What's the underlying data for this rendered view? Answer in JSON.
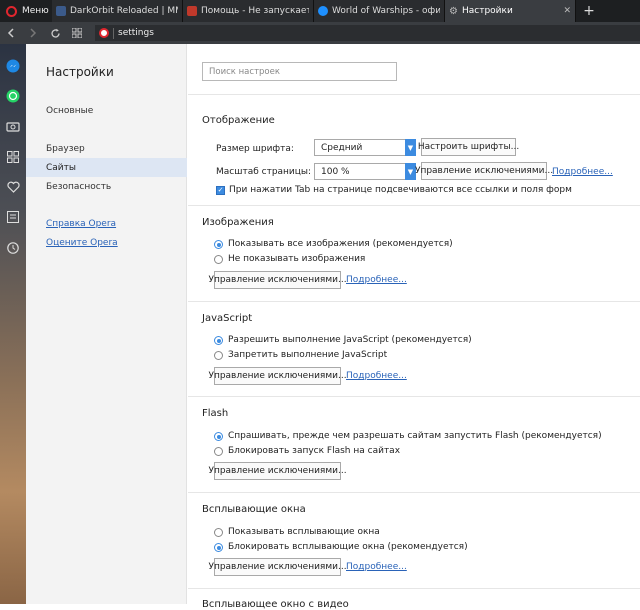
{
  "browser": {
    "menu_label": "Меню",
    "tabs": [
      {
        "title": "DarkOrbit Reloaded | MMO",
        "favicon_color": "#3b5a8a"
      },
      {
        "title": "Помощь - Не запускается",
        "favicon_color": "#c0392b"
      },
      {
        "title": "World of Warships - офиц",
        "favicon_color": "#1e90ff"
      },
      {
        "title": "Настройки",
        "favicon_color": "#9aa0a6"
      }
    ],
    "new_tab_symbol": "+",
    "address": "settings"
  },
  "settings_nav": {
    "title": "Настройки",
    "items": [
      "Основные",
      "Браузер",
      "Сайты",
      "Безопасность"
    ],
    "selected_index": 2,
    "links": [
      "Справка Opera",
      "Оцените Opera"
    ]
  },
  "search": {
    "placeholder": "Поиск настроек"
  },
  "display": {
    "title": "Отображение",
    "font_size_label": "Размер шрифта:",
    "font_size_value": "Средний",
    "configure_fonts_button": "Настроить шрифты...",
    "zoom_label": "Масштаб страницы:",
    "zoom_value": "100 %",
    "manage_exceptions_button": "Управление исключениями...",
    "more_link": "Подробнее...",
    "tab_highlight_label": "При нажатии Tab на странице подсвечиваются все ссылки и поля форм",
    "tab_highlight_checked": true
  },
  "images": {
    "title": "Изображения",
    "options": [
      "Показывать все изображения (рекомендуется)",
      "Не показывать изображения"
    ],
    "selected_index": 0,
    "manage_button": "Управление исключениями...",
    "more_link": "Подробнее..."
  },
  "javascript": {
    "title": "JavaScript",
    "options": [
      "Разрешить выполнение JavaScript (рекомендуется)",
      "Запретить выполнение JavaScript"
    ],
    "selected_index": 0,
    "manage_button": "Управление исключениями...",
    "more_link": "Подробнее..."
  },
  "flash": {
    "title": "Flash",
    "options": [
      "Спрашивать, прежде чем разрешать сайтам запустить Flash (рекомендуется)",
      "Блокировать запуск Flash на сайтах"
    ],
    "selected_index": 0,
    "manage_button": "Управление исключениями..."
  },
  "popups": {
    "title": "Всплывающие окна",
    "options": [
      "Показывать всплывающие окна",
      "Блокировать всплывающие окна (рекомендуется)"
    ],
    "selected_index": 1,
    "manage_button": "Управление исключениями...",
    "more_link": "Подробнее..."
  },
  "next_section": {
    "title": "Всплывающее окно с видео"
  }
}
